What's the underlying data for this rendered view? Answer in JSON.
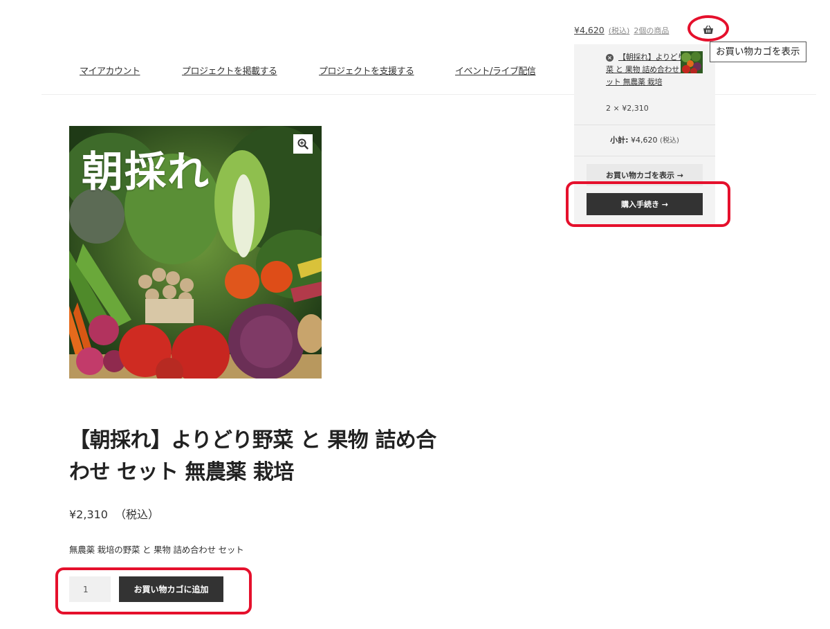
{
  "header": {
    "cart_amount": "¥4,620",
    "cart_tax": "(税込)",
    "cart_count": "2個の商品",
    "cart_tooltip": "お買い物カゴを表示"
  },
  "nav": {
    "items": [
      {
        "label": "マイアカウント"
      },
      {
        "label": "プロジェクトを掲載する"
      },
      {
        "label": "プロジェクトを支援する"
      },
      {
        "label": "イベント/ライブ配信"
      }
    ]
  },
  "mini_cart": {
    "item_name": "【朝採れ】よりどり野菜 と 果物 詰め合わせ セット 無農薬 栽培",
    "item_qty_price": "2 × ¥2,310",
    "subtotal_label": "小計:",
    "subtotal_value": "¥4,620",
    "subtotal_tax": "(税込)",
    "view_cart_label": "お買い物カゴを表示 →",
    "checkout_label": "購入手続き →"
  },
  "product": {
    "image_caption": "朝採れ",
    "title": "【朝採れ】よりどり野菜 と 果物 詰め合わせ セット 無農薬 栽培",
    "price": "¥2,310",
    "price_tax": "（税込）",
    "description": "無農薬 栽培の野菜 と 果物 詰め合わせ セット",
    "quantity": "1",
    "add_to_cart_label": "お買い物カゴに追加"
  },
  "colors": {
    "accent_dark": "#333333",
    "highlight_red": "#e5102c"
  },
  "icons": {
    "cart": "basket-icon",
    "zoom": "zoom-icon",
    "remove": "remove-icon"
  }
}
